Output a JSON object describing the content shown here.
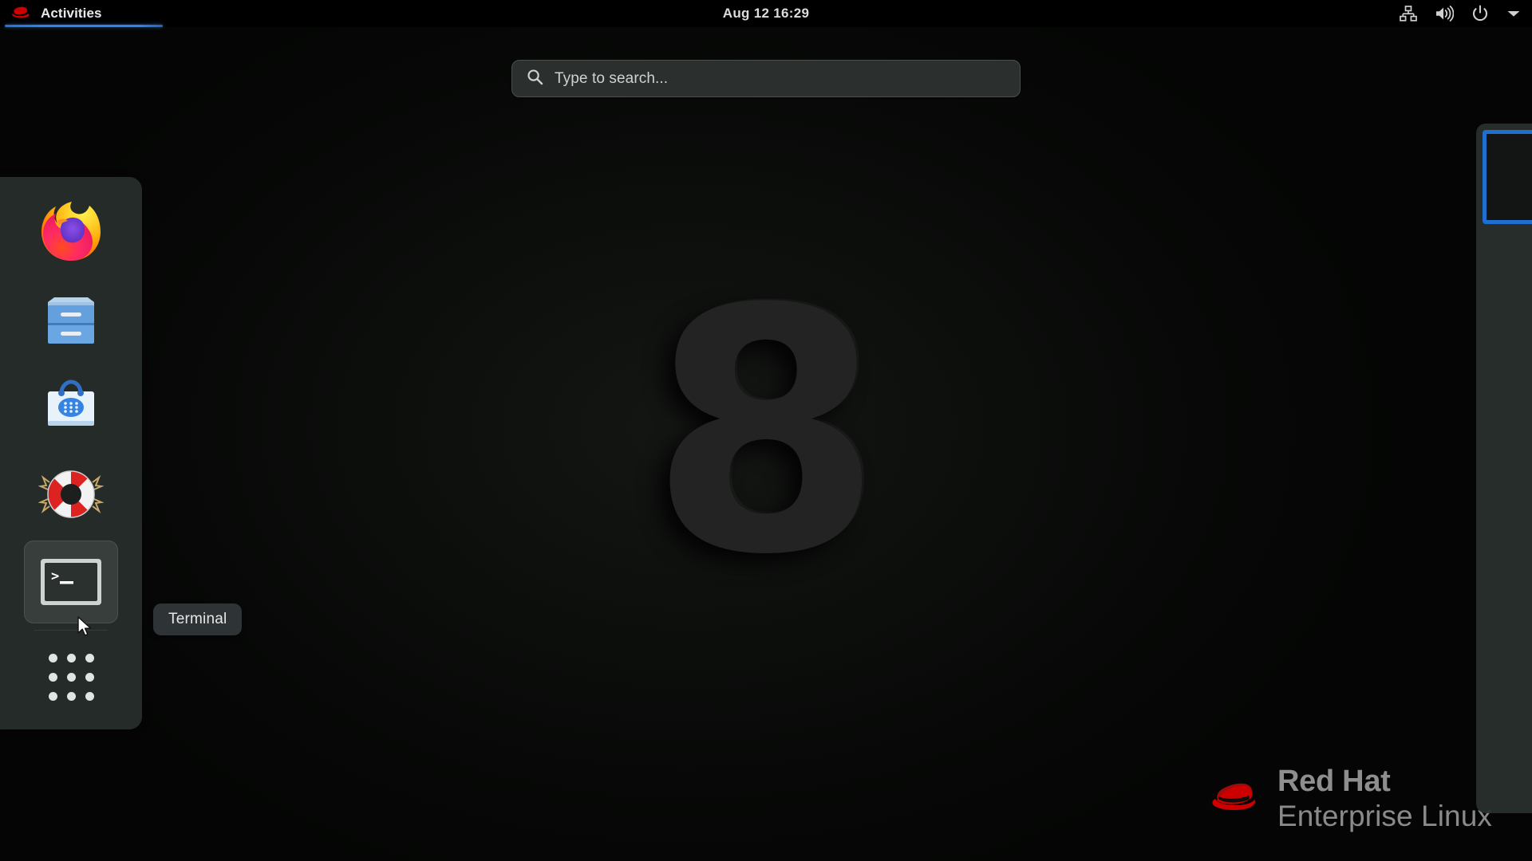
{
  "topbar": {
    "activities_label": "Activities",
    "activities_icon": "redhat-logo-icon",
    "clock": "Aug 12  16:29",
    "system_icons": [
      {
        "name": "network-wired-icon",
        "label": "Network"
      },
      {
        "name": "volume-icon",
        "label": "Volume"
      },
      {
        "name": "power-icon",
        "label": "Power"
      },
      {
        "name": "chevron-down-icon",
        "label": "System menu"
      }
    ]
  },
  "search": {
    "placeholder": "Type to search...",
    "value": "",
    "icon": "search-icon"
  },
  "dock": {
    "items": [
      {
        "name": "firefox",
        "label": "Firefox",
        "icon": "firefox-icon",
        "active": false
      },
      {
        "name": "files",
        "label": "Files",
        "icon": "files-cabinet-icon",
        "active": false
      },
      {
        "name": "software",
        "label": "Software",
        "icon": "software-bag-icon",
        "active": false
      },
      {
        "name": "help",
        "label": "Help",
        "icon": "lifering-help-icon",
        "active": false
      },
      {
        "name": "terminal",
        "label": "Terminal",
        "icon": "terminal-icon",
        "active": true
      }
    ],
    "show_apps_label": "Show Applications",
    "show_apps_icon": "grid-dots-icon"
  },
  "tooltip": {
    "text": "Terminal"
  },
  "workspaces": {
    "selected_index": 0,
    "selected_border_color": "#1f6fd0"
  },
  "wallpaper": {
    "numeral": "8"
  },
  "branding": {
    "line1": "Red Hat",
    "line2": "Enterprise Linux",
    "logo_icon": "redhat-fedora-icon",
    "logo_color": "#cc0000"
  },
  "colors": {
    "topbar_bg": "#000000",
    "dock_bg": "#272e2b",
    "accent_blue": "#3584e4",
    "search_bg": "#2b302e",
    "tooltip_bg": "#2e3436"
  }
}
